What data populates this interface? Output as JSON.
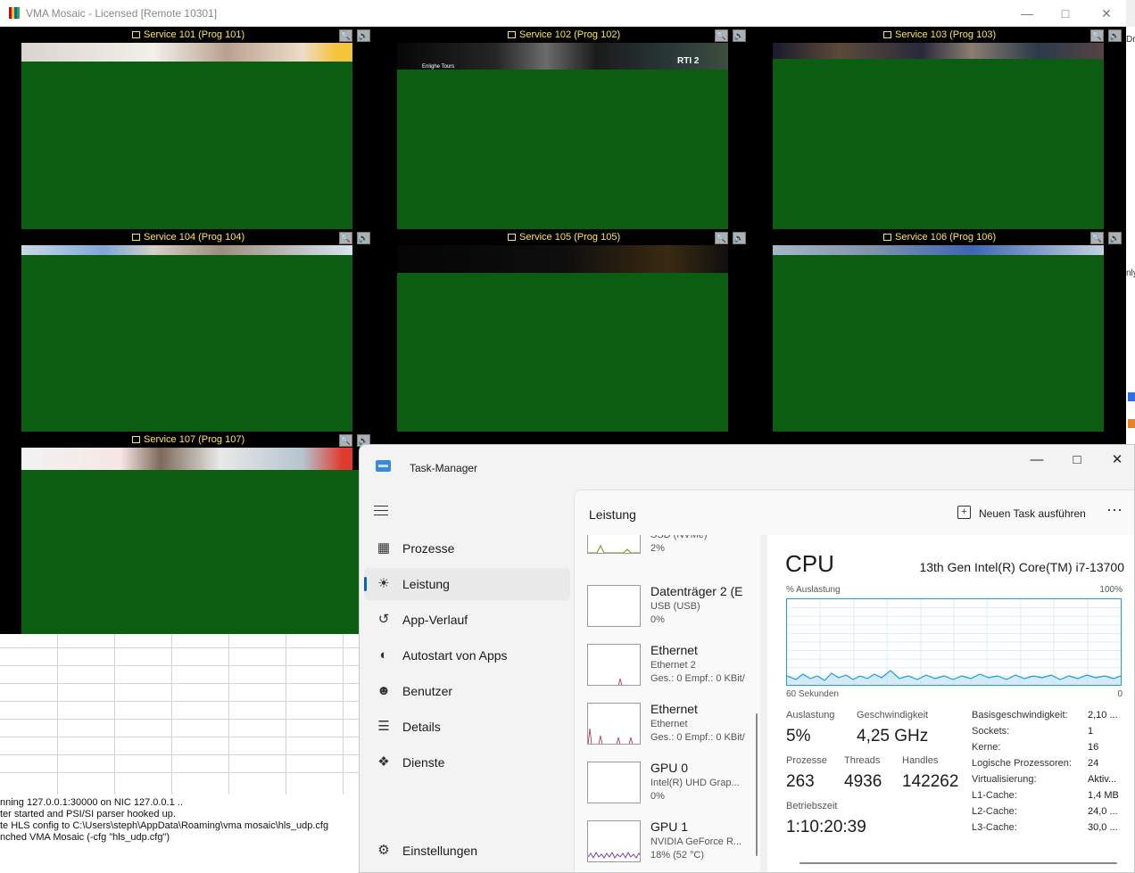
{
  "vma": {
    "title": "VMA Mosaic - Licensed  [Remote 10301]",
    "tiles": [
      {
        "label": "Service 101 (Prog 101)"
      },
      {
        "label": "Service 102 (Prog 102)"
      },
      {
        "label": "Service 103 (Prog 103)"
      },
      {
        "label": "Service 104 (Prog 104)"
      },
      {
        "label": "Service 105 (Prog 105)"
      },
      {
        "label": "Service 106 (Prog 106)"
      },
      {
        "label": "Service 107 (Prog 107)"
      }
    ],
    "overlay_text": {
      "rti": "RTI 2",
      "caption": "Enlighe Tours"
    }
  },
  "console": {
    "lines": [
      "nning 127.0.0.1:30000 on NIC 127.0.0.1 ..",
      "ter started and PSI/SI parser hooked up.",
      "te HLS config to C:\\Users\\steph\\AppData\\Roaming\\vma mosaic\\hls_udp.cfg",
      "nched VMA Mosaic (-cfg \"hls_udp.cfg\")"
    ]
  },
  "background_edge": {
    "text_top": "Dr",
    "text_mid": "nly"
  },
  "taskmanager": {
    "title": "Task-Manager",
    "nav": [
      {
        "label": "Prozesse",
        "icon": "grid-icon"
      },
      {
        "label": "Leistung",
        "icon": "performance-icon"
      },
      {
        "label": "App-Verlauf",
        "icon": "history-icon"
      },
      {
        "label": "Autostart von Apps",
        "icon": "speedometer-icon"
      },
      {
        "label": "Benutzer",
        "icon": "users-icon"
      },
      {
        "label": "Details",
        "icon": "list-icon"
      },
      {
        "label": "Dienste",
        "icon": "puzzle-icon"
      }
    ],
    "settings_label": "Einstellungen",
    "panel_title": "Leistung",
    "new_task_label": "Neuen Task ausführen",
    "devices": [
      {
        "name": "",
        "sub1": "SSD (NVMe)",
        "sub2": "2%",
        "color": "#6a8f1a"
      },
      {
        "name": "Datenträger 2 (E",
        "sub1": "USB (USB)",
        "sub2": "0%",
        "color": "#6a8f1a"
      },
      {
        "name": "Ethernet",
        "sub1": "Ethernet 2",
        "sub2": "Ges.: 0 Empf.: 0 KBit/",
        "color": "#b84a5a"
      },
      {
        "name": "Ethernet",
        "sub1": "Ethernet",
        "sub2": "Ges.: 0 Empf.: 0 KBit/",
        "color": "#b84a5a"
      },
      {
        "name": "GPU 0",
        "sub1": "Intel(R) UHD Grap...",
        "sub2": "0%",
        "color": "#7a3fb0"
      },
      {
        "name": "GPU 1",
        "sub1": "NVIDIA GeForce R...",
        "sub2": "18% (52 °C)",
        "color": "#7a3fb0"
      }
    ],
    "cpu": {
      "title": "CPU",
      "model": "13th Gen Intel(R) Core(TM) i7-13700",
      "graph_label": "% Auslastung",
      "graph_max": "100%",
      "graph_time": "60 Sekunden",
      "graph_min": "0",
      "graph_color": "#1f9ad6",
      "stats": {
        "auslastung_label": "Auslastung",
        "auslastung": "5%",
        "speed_label": "Geschwindigkeit",
        "speed": "4,25 GHz",
        "prozesse_label": "Prozesse",
        "prozesse": "263",
        "threads_label": "Threads",
        "threads": "4936",
        "handles_label": "Handles",
        "handles": "142262",
        "uptime_label": "Betriebszeit",
        "uptime": "1:10:20:39"
      },
      "info": [
        {
          "k": "Basisgeschwindigkeit:",
          "v": "2,10 ..."
        },
        {
          "k": "Sockets:",
          "v": "1"
        },
        {
          "k": "Kerne:",
          "v": "16"
        },
        {
          "k": "Logische Prozessoren:",
          "v": "24"
        },
        {
          "k": "Virtualisierung:",
          "v": "Aktiv..."
        },
        {
          "k": "L1-Cache:",
          "v": "1,4 MB"
        },
        {
          "k": "L2-Cache:",
          "v": "24,0 ..."
        },
        {
          "k": "L3-Cache:",
          "v": "30,0 ..."
        }
      ]
    }
  }
}
